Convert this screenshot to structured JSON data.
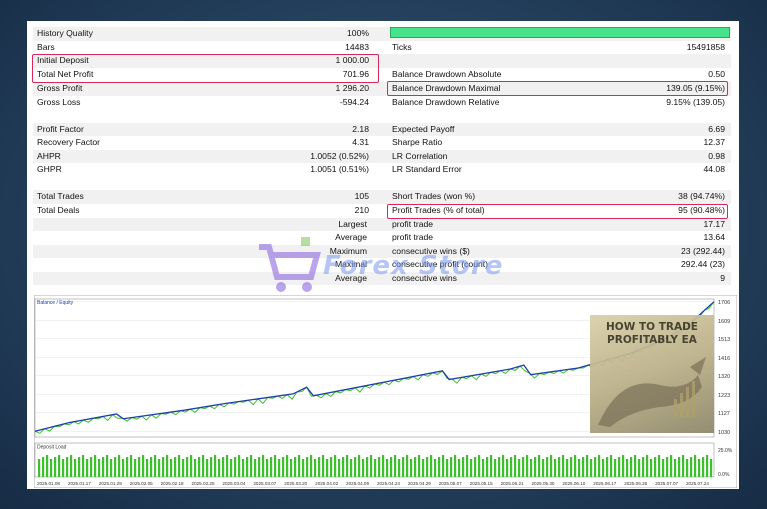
{
  "report": {
    "left_rows": [
      {
        "label": "History Quality",
        "value": "100%"
      },
      {
        "label": "Bars",
        "value": "14483"
      },
      {
        "label": "Initial Deposit",
        "value": "1 000.00"
      },
      {
        "label": "Total Net Profit",
        "value": "701.96"
      },
      {
        "label": "Gross Profit",
        "value": "1 296.20"
      },
      {
        "label": "Gross Loss",
        "value": "-594.24"
      },
      {
        "label": "Profit Factor",
        "value": "2.18"
      },
      {
        "label": "Recovery Factor",
        "value": "4.31"
      },
      {
        "label": "AHPR",
        "value": "1.0052 (0.52%)"
      },
      {
        "label": "GHPR",
        "value": "1.0051 (0.51%)"
      },
      {
        "label": "Total Trades",
        "value": "105"
      },
      {
        "label": "Total Deals",
        "value": "210"
      },
      {
        "label": "Largest",
        "value": ""
      },
      {
        "label": "Average",
        "value": ""
      },
      {
        "label": "Maximum",
        "value": ""
      },
      {
        "label": "Maximal",
        "value": ""
      },
      {
        "label": "Average",
        "value": ""
      }
    ],
    "right_rows": [
      {
        "label": "",
        "value": ""
      },
      {
        "label": "Ticks",
        "value": "15491858"
      },
      {
        "label": "",
        "value": ""
      },
      {
        "label": "Balance Drawdown Absolute",
        "value": "0.50"
      },
      {
        "label": "Balance Drawdown Maximal",
        "value": "139.05 (9.15%)"
      },
      {
        "label": "Balance Drawdown Relative",
        "value": "9.15% (139.05)"
      },
      {
        "label": "Expected Payoff",
        "value": "6.69"
      },
      {
        "label": "Sharpe Ratio",
        "value": "12.37"
      },
      {
        "label": "LR Correlation",
        "value": "0.98"
      },
      {
        "label": "LR Standard Error",
        "value": "44.08"
      },
      {
        "label": "Short Trades (won %)",
        "value": "38 (94.74%)"
      },
      {
        "label": "Profit Trades (% of total)",
        "value": "95 (90.48%)"
      },
      {
        "label": "profit trade",
        "value": "17.17"
      },
      {
        "label": "profit trade",
        "value": "13.64"
      },
      {
        "label": "consecutive wins ($)",
        "value": "23 (292.44)"
      },
      {
        "label": "consecutive profit (count)",
        "value": "292.44 (23)"
      },
      {
        "label": "consecutive wins",
        "value": "9"
      }
    ]
  },
  "watermark": {
    "text": "Forex Store"
  },
  "ad": {
    "title_line1": "HOW TO TRADE",
    "title_line2": "PROFITABLY EA"
  },
  "chart_data": [
    {
      "type": "line",
      "title": "Balance / Equity",
      "series": [
        {
          "name": "Balance",
          "color": "#1e3fa8"
        },
        {
          "name": "Equity",
          "color": "#3fbf2f"
        }
      ],
      "ylim": [
        1000,
        1720
      ],
      "y_ticks": [
        "1706",
        "1609",
        "1513",
        "1416",
        "1320",
        "1223",
        "1127",
        "1030"
      ],
      "balance_points": [
        [
          0,
          1030
        ],
        [
          0.05,
          1075
        ],
        [
          0.12,
          1120
        ],
        [
          0.13,
          1095
        ],
        [
          0.22,
          1140
        ],
        [
          0.28,
          1175
        ],
        [
          0.38,
          1225
        ],
        [
          0.4,
          1260
        ],
        [
          0.41,
          1215
        ],
        [
          0.52,
          1290
        ],
        [
          0.6,
          1345
        ],
        [
          0.61,
          1300
        ],
        [
          0.7,
          1355
        ],
        [
          0.72,
          1375
        ],
        [
          0.73,
          1325
        ],
        [
          0.8,
          1360
        ],
        [
          0.86,
          1420
        ],
        [
          0.88,
          1440
        ],
        [
          0.92,
          1500
        ],
        [
          0.95,
          1555
        ],
        [
          0.97,
          1610
        ],
        [
          1.0,
          1706
        ]
      ]
    },
    {
      "type": "bar",
      "title": "Deposit Load",
      "y_ticks": [
        "25.0%",
        "0.0%"
      ],
      "dates": [
        "2025.01.08",
        "2025.01.17",
        "2025.01.29",
        "2025.02.05",
        "2025.02.18",
        "2025.02.25",
        "2025.03.04",
        "2025.03.07",
        "2025.03.20",
        "2025.04.02",
        "2025.04.09",
        "2025.04.24",
        "2025.04.29",
        "2025.05.07",
        "2025.05.15",
        "2025.05.21",
        "2025.05.30",
        "2025.06.10",
        "2025.06.17",
        "2025.06.26",
        "2025.07.07",
        "2025.07.24"
      ]
    }
  ]
}
